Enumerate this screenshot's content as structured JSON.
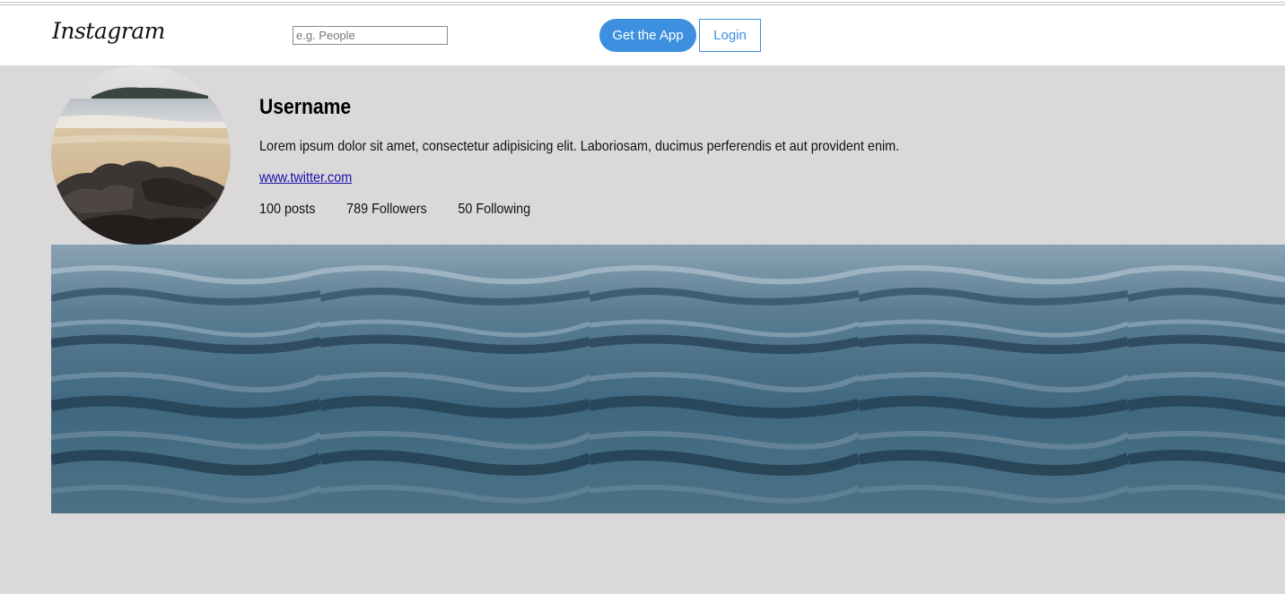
{
  "app": {
    "logo_text": "Instagram"
  },
  "header": {
    "search_placeholder": "e.g. People",
    "get_app_label": "Get the App",
    "login_label": "Login",
    "accent_color": "#3d8fe0"
  },
  "profile": {
    "username": "Username",
    "bio": "Lorem ipsum dolor sit amet, consectetur adipisicing elit. Laboriosam, ducimus perferendis et aut provident enim.",
    "website": "www.twitter.com",
    "posts": "100 posts",
    "followers": "789 Followers",
    "following": "50 Following"
  },
  "gallery": {
    "tile_count": 5,
    "tile_image": "ocean-water-photo"
  }
}
